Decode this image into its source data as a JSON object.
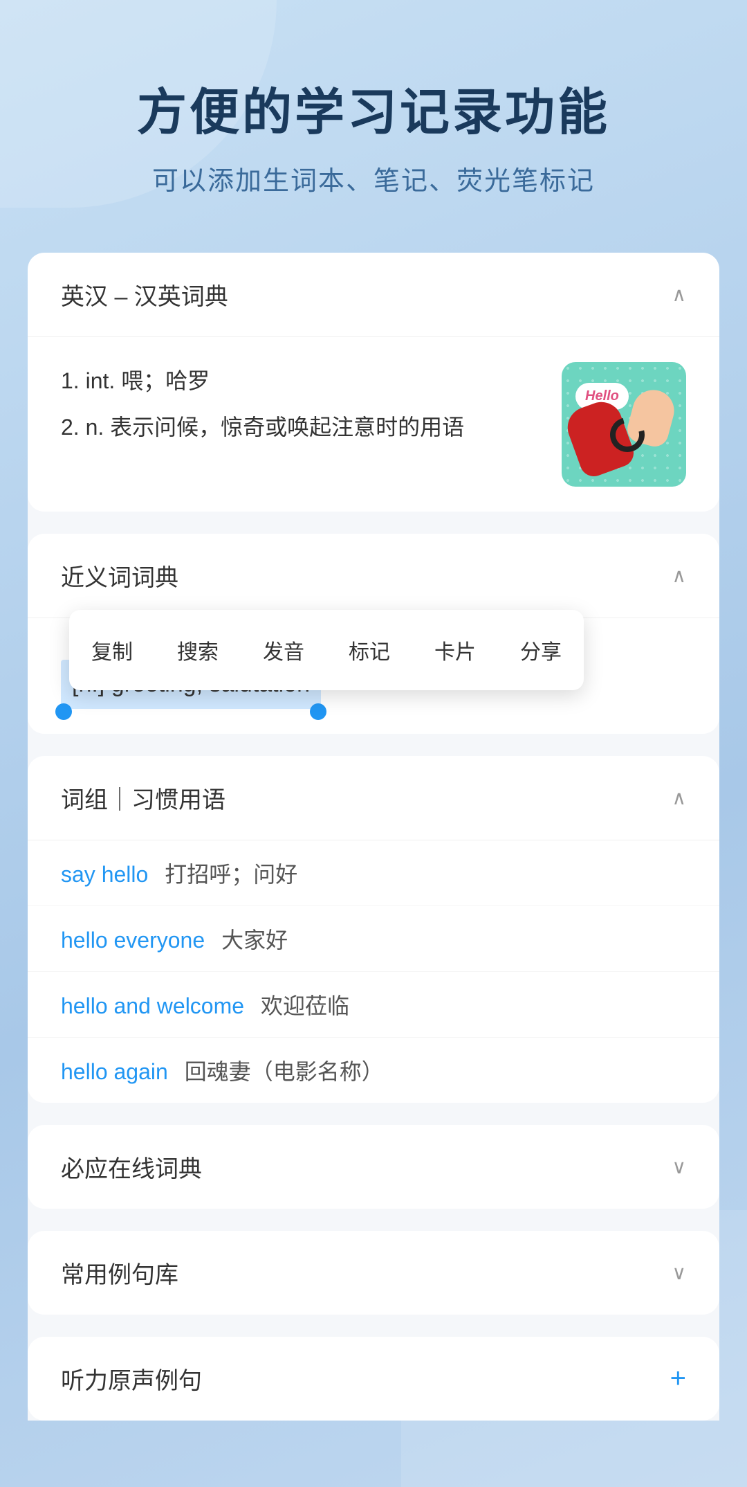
{
  "header": {
    "title": "方便的学习记录功能",
    "subtitle": "可以添加生词本、笔记、荧光笔标记"
  },
  "en_cn_dict": {
    "section_title": "英汉 – 汉英词典",
    "definition1": "1. int. 喂；哈罗",
    "definition2": "2. n. 表示问候，惊奇或唤起注意时的用语",
    "image_alt": "hello telephone"
  },
  "synonym_dict": {
    "section_title": "近义词词典",
    "selected_text": "[n.] greeting, salutation",
    "context_menu": {
      "items": [
        "复制",
        "搜索",
        "发音",
        "标记",
        "卡片",
        "分享"
      ]
    }
  },
  "phrases": {
    "section_title": "词组｜习惯用语",
    "items": [
      {
        "english": "say hello",
        "chinese": "打招呼；问好"
      },
      {
        "english": "hello everyone",
        "chinese": "大家好"
      },
      {
        "english": "hello and welcome",
        "chinese": "欢迎莅临"
      },
      {
        "english": "hello again",
        "chinese": "回魂妻（电影名称）"
      }
    ]
  },
  "collapsed_sections": [
    {
      "title": "必应在线词典"
    },
    {
      "title": "常用例句库"
    }
  ],
  "plus_section": {
    "title": "听力原声例句",
    "icon": "+"
  }
}
